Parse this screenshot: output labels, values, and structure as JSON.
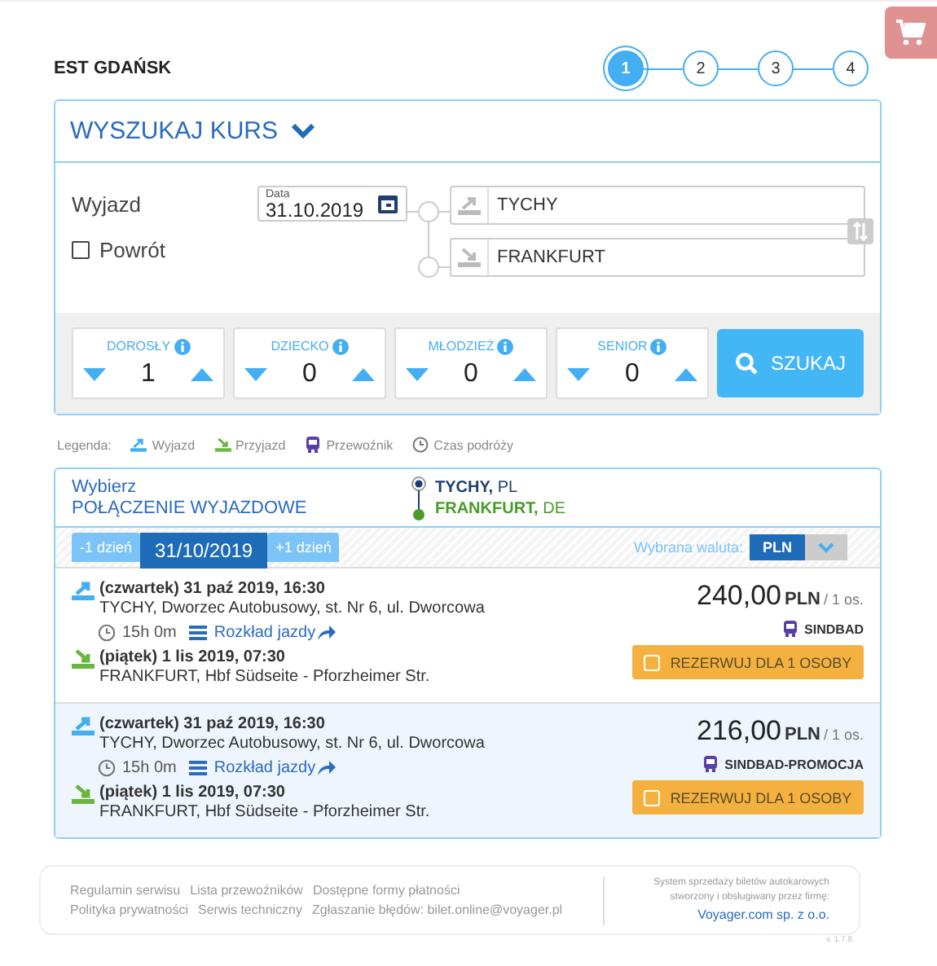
{
  "header": {
    "title": "EST GDAŃSK",
    "steps": [
      {
        "label": "1",
        "selected": true
      },
      {
        "label": "2",
        "selected": false
      },
      {
        "label": "3",
        "selected": false
      },
      {
        "label": "4",
        "selected": false
      }
    ]
  },
  "search": {
    "title": "WYSZUKAJ KURS",
    "departure_label": "Wyjazd",
    "date": {
      "label": "Data",
      "value": "31.10.2019"
    },
    "return": {
      "label": "Powrót",
      "checked": false
    },
    "from": "TYCHY",
    "to": "FRANKFURT",
    "passengers": [
      {
        "label": "DOROSŁY",
        "value": "1"
      },
      {
        "label": "DZIECKO",
        "value": "0"
      },
      {
        "label": "MŁODZIEŻ",
        "value": "0"
      },
      {
        "label": "SENIOR",
        "value": "0"
      }
    ],
    "search_button": "SZUKAJ"
  },
  "legend": {
    "label": "Legenda:",
    "items": [
      {
        "kind": "departure",
        "label": "Wyjazd"
      },
      {
        "kind": "arrival",
        "label": "Przyjazd"
      },
      {
        "kind": "carrier",
        "label": "Przewoźnik"
      },
      {
        "kind": "time",
        "label": "Czas podróży"
      }
    ]
  },
  "results": {
    "title_line1": "Wybierz",
    "title_line2": "POŁĄCZENIE WYJAZDOWE",
    "from_city": "TYCHY,",
    "from_country": "PL",
    "to_city": "FRANKFURT,",
    "to_country": "DE",
    "prev_day": "-1 dzień",
    "date": "31/10/2019",
    "next_day": "+1 dzień",
    "currency_label": "Wybrana waluta:",
    "currency": "PLN",
    "connections": [
      {
        "dep_time": "(czwartek) 31 paź 2019, 16:30",
        "dep_place": "TYCHY, Dworzec Autobusowy, st. Nr 6, ul. Dworcowa",
        "duration": "15h 0m",
        "timetable": "Rozkład jazdy",
        "arr_time": "(piątek) 1 lis 2019, 07:30",
        "arr_place": "FRANKFURT, Hbf Südseite - Pforzheimer Str.",
        "price": "240,00",
        "currency": "PLN",
        "per": "/ 1 os.",
        "carrier": "SINDBAD",
        "book": "REZERWUJ DLA 1 OSOBY",
        "selected": false
      },
      {
        "dep_time": "(czwartek) 31 paź 2019, 16:30",
        "dep_place": "TYCHY, Dworzec Autobusowy, st. Nr 6, ul. Dworcowa",
        "duration": "15h 0m",
        "timetable": "Rozkład jazdy",
        "arr_time": "(piątek) 1 lis 2019, 07:30",
        "arr_place": "FRANKFURT, Hbf Südseite - Pforzheimer Str.",
        "price": "216,00",
        "currency": "PLN",
        "per": "/ 1 os.",
        "carrier": "SINDBAD-PROMOCJA",
        "book": "REZERWUJ DLA 1 OSOBY",
        "selected": true
      }
    ]
  },
  "footer": {
    "links_row1": [
      "Regulamin serwisu",
      "Lista przewoźników",
      "Dostępne formy płatności"
    ],
    "links_row2": [
      "Polityka prywatności",
      "Serwis techniczny",
      "Zgłaszanie błędów: bilet.online@voyager.pl"
    ],
    "info_line1": "System sprzedaży biletów autokarowych",
    "info_line2": "stworzony i obsługiwany przez firmę:",
    "company": "Voyager.com sp. z o.o.",
    "version": "v. 1.7.8"
  }
}
